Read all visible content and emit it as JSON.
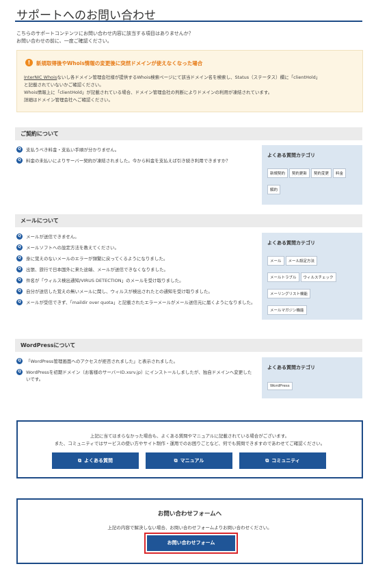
{
  "page": {
    "title": "サポートへのお問い合わせ",
    "intro_line1": "こちらのサポートコンテンツにお問い合わせ内容に該当する項目はありませんか？",
    "intro_line2": "お問い合わせの前に、一度ご確認ください。"
  },
  "alert": {
    "icon_symbol": "!",
    "heading": "新規取得後やWhois情報の変更後に突然ドメインが使えなくなった場合",
    "link_text": "InterNIC Whois",
    "line1_rest": "ないし各ドメイン管理会社様が提供するWhois検索ページにて該当ドメイン名を検索し、Status（ステータス）欄に「clientHold」",
    "line2": "と記載されていないかご確認ください。",
    "line3": "Whois情報上に「clientHold」が記載されている場合、ドメイン管理会社の判断によりドメインの利用が凍結されています。",
    "line4": "詳細はドメイン管理会社へご確認ください。"
  },
  "q_icon_symbol": "Q",
  "sections": [
    {
      "heading": "ご契約について",
      "questions": [
        "支払うべき料金・支払い手順が分かりません。",
        "料金の未払いによりサーバー契約が凍結されました。今から料金を支払えば引き続き利用できますか？"
      ],
      "category_title": "よくある質問カテゴリ",
      "tags": [
        "新規契約",
        "契約更新",
        "契約変更",
        "料金",
        "解約"
      ]
    },
    {
      "heading": "メールについて",
      "questions": [
        "メールが送信できません。",
        "メールソフトへの設定方法を教えてください。",
        "身に覚えのないメールのエラーが頻繁に戻ってくるようになりました。",
        "出張、旅行で日本国外に来た途端、メールが送信できなくなりました。",
        "件名が「ウィルス検出通知/VIRUS DETECTION」のメールを受け取りました。",
        "自分が送信した覚えの無いメールに関し、ウィルスが検出されたとの通知を受け取りました。",
        "メールが受信できず、「maildir over quota」と記載されたエラーメールがメール送信元に届くようになりました。"
      ],
      "category_title": "よくある質問カテゴリ",
      "tags": [
        "メール",
        "メール設定方法",
        "メールトラブル",
        "ウィルスチェック",
        "メーリングリスト機能",
        "メールマガジン機能"
      ]
    },
    {
      "heading": "WordPressについて",
      "questions": [
        "「WordPress管理画面へのアクセスが拒否されました」と表示されました。",
        "WordPressを初期ドメイン（お客様のサーバーID.xsrv.jp）にインストールしましたが、独自ドメインへ変更したいです。"
      ],
      "category_title": "よくある質問カテゴリ",
      "tags": [
        "WordPress"
      ]
    }
  ],
  "resources": {
    "line1": "上記に当てはまらなかった場合も、よくある質問やマニュアルに記載されている場合がございます。",
    "line2": "また、コミュニティではサービスの使い方やサイト制作・運用でのお困りごとなど、何でも質問できますのであわせてご確認ください。",
    "ext_icon": "⧉",
    "buttons": [
      "よくある質問",
      "マニュアル",
      "コミュニティ"
    ]
  },
  "contact": {
    "title": "お問い合わせフォームへ",
    "text": "上記の内容で解決しない場合、お問い合わせフォームよりお問い合わせください。",
    "button": "お問い合わせフォーム"
  },
  "colors": {
    "accent": "#1c4a86",
    "button": "#1f5597",
    "alert_heading": "#e67a16",
    "highlight": "#d9262a",
    "category_bg": "#dbe6f1"
  }
}
